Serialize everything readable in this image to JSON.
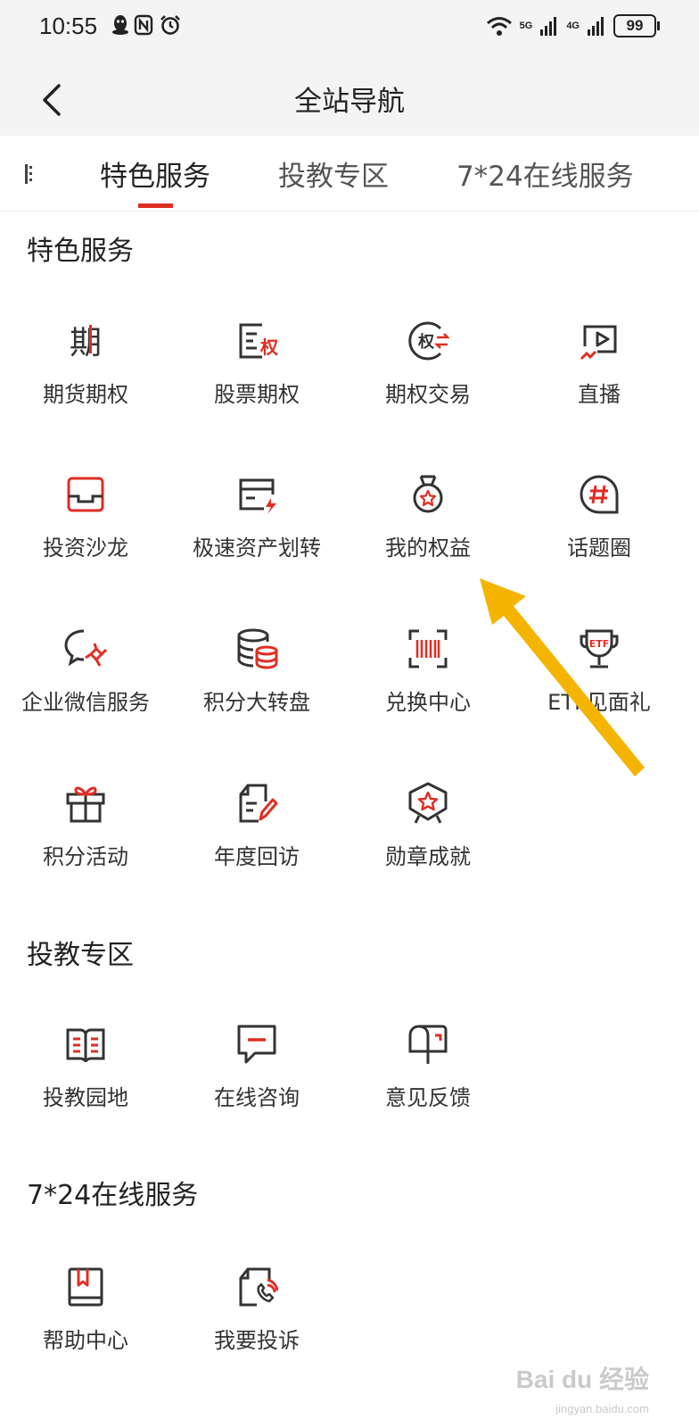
{
  "status_bar": {
    "time": "10:55",
    "network_5g": "5G",
    "network_4g": "4G",
    "battery": "99"
  },
  "header": {
    "title": "全站导航",
    "back_icon": "chevron-left-icon"
  },
  "tabs": [
    {
      "label": "特色服务",
      "active": true
    },
    {
      "label": "投教专区",
      "active": false
    },
    {
      "label": "7*24在线服务",
      "active": false
    }
  ],
  "sections": [
    {
      "title": "特色服务",
      "items": [
        {
          "label": "期货期权",
          "icon": "futures-icon"
        },
        {
          "label": "股票期权",
          "icon": "stock-option-icon"
        },
        {
          "label": "期权交易",
          "icon": "option-trade-icon"
        },
        {
          "label": "直播",
          "icon": "live-video-icon"
        },
        {
          "label": "投资沙龙",
          "icon": "salon-inbox-icon"
        },
        {
          "label": "极速资产划转",
          "icon": "fast-transfer-icon"
        },
        {
          "label": "我的权益",
          "icon": "medal-icon"
        },
        {
          "label": "话题圈",
          "icon": "hashtag-bubble-icon"
        },
        {
          "label": "企业微信服务",
          "icon": "wechat-work-icon"
        },
        {
          "label": "积分大转盘",
          "icon": "database-wheel-icon"
        },
        {
          "label": "兑换中心",
          "icon": "barcode-scan-icon"
        },
        {
          "label": "ETF见面礼",
          "icon": "etf-trophy-icon"
        },
        {
          "label": "积分活动",
          "icon": "gift-icon"
        },
        {
          "label": "年度回访",
          "icon": "edit-document-icon"
        },
        {
          "label": "勋章成就",
          "icon": "badge-star-icon"
        }
      ]
    },
    {
      "title": "投教专区",
      "items": [
        {
          "label": "投教园地",
          "icon": "open-book-icon"
        },
        {
          "label": "在线咨询",
          "icon": "chat-message-icon"
        },
        {
          "label": "意见反馈",
          "icon": "mailbox-icon"
        }
      ]
    },
    {
      "title": "7*24在线服务",
      "items": [
        {
          "label": "帮助中心",
          "icon": "bookmark-book-icon"
        },
        {
          "label": "我要投诉",
          "icon": "complaint-phone-icon"
        }
      ]
    }
  ],
  "icon_glyphs": {
    "futures": "期",
    "stock_option": "权",
    "option_trade": "权",
    "etf": "ETF"
  },
  "colors": {
    "accent": "#e02e24",
    "icon_stroke": "#333333",
    "highlight_arrow": "#f5b400"
  },
  "watermark": {
    "main": "Bai du 经验",
    "sub": "jingyan.baidu.com"
  }
}
